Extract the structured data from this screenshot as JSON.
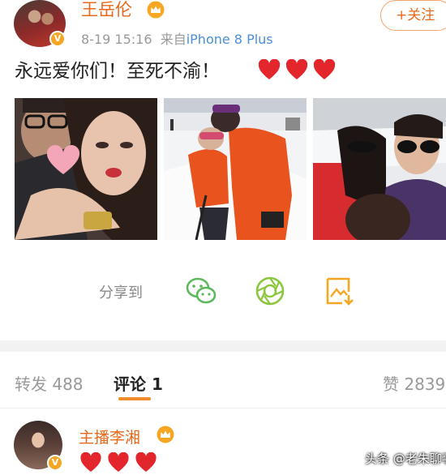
{
  "post": {
    "author": "王岳伦",
    "time": "8-19 15:16",
    "source_prefix": "来自",
    "device": "iPhone 8 Plus",
    "follow_label": "+关注",
    "text": "永远爱你们！至死不渝！",
    "verified_mark": "V"
  },
  "share": {
    "label": "分享到",
    "icons": [
      "wechat-icon",
      "moments-icon",
      "save-image-icon"
    ]
  },
  "tabs": {
    "repost": "转发 488",
    "comments": "评论 1",
    "likes": "赞 2839"
  },
  "comment": {
    "author": "主播李湘",
    "verified_mark": "V"
  },
  "watermark": "头条 @老朱聊事",
  "colors": {
    "accent": "#e8681a",
    "heart": "#e3262b",
    "device_link": "#4a8fd8",
    "wechat": "#5cb85c",
    "moments": "#8cc63f",
    "save": "#f5a623"
  }
}
